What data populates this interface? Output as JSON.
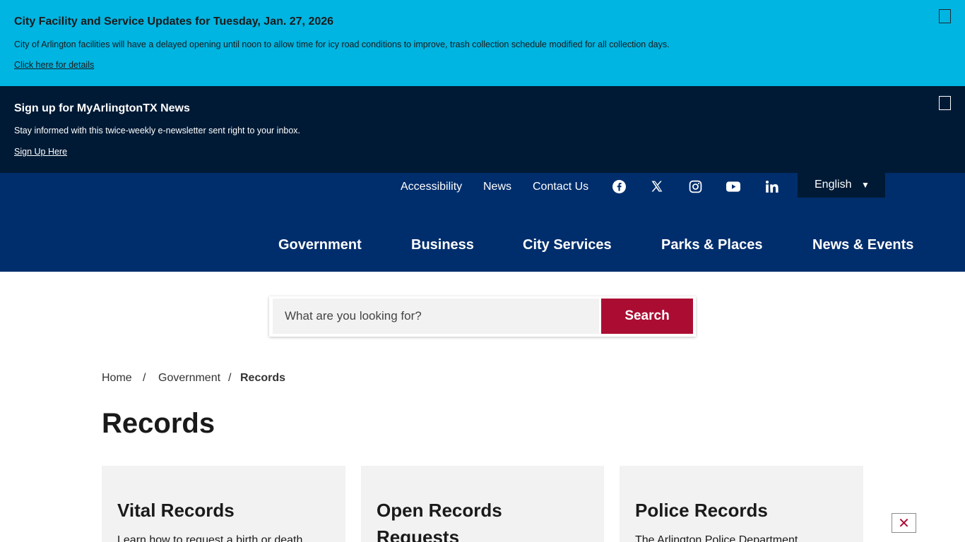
{
  "alert": {
    "title": "City Facility and Service Updates for Tuesday, Jan. 27, 2026",
    "text": "City of Arlington facilities will have a delayed opening until noon to allow time for icy road conditions to improve, trash collection schedule modified for all collection days.",
    "link": "Click here for details"
  },
  "newsletter": {
    "title": "Sign up for MyArlingtonTX News",
    "text": "Stay informed with this twice-weekly e-newsletter sent right to your inbox.",
    "link": "Sign Up Here"
  },
  "utility_nav": {
    "links": [
      "Accessibility",
      "News",
      "Contact Us"
    ],
    "social_icons": [
      "facebook-icon",
      "x-icon",
      "instagram-icon",
      "youtube-icon",
      "linkedin-icon"
    ],
    "language": "English"
  },
  "main_nav": [
    "Government",
    "Business",
    "City Services",
    "Parks & Places",
    "News & Events"
  ],
  "search": {
    "placeholder": "What are you looking for?",
    "button": "Search"
  },
  "breadcrumb": {
    "items": [
      "Home",
      "Government"
    ],
    "separator": "/",
    "current": "Records"
  },
  "page_title": "Records",
  "cards": [
    {
      "title": "Vital Records",
      "text": "Learn how to request a birth or death"
    },
    {
      "title": "Open Records Requests",
      "text": ""
    },
    {
      "title": "Police Records",
      "text": "The Arlington Police Department"
    }
  ],
  "float_close": "✕",
  "colors": {
    "alert_bg": "#00b5e2",
    "newsletter_bg": "#001a35",
    "header_bg": "#002e6d",
    "search_button": "#ab0d32",
    "card_bg": "#f2f2f2"
  }
}
